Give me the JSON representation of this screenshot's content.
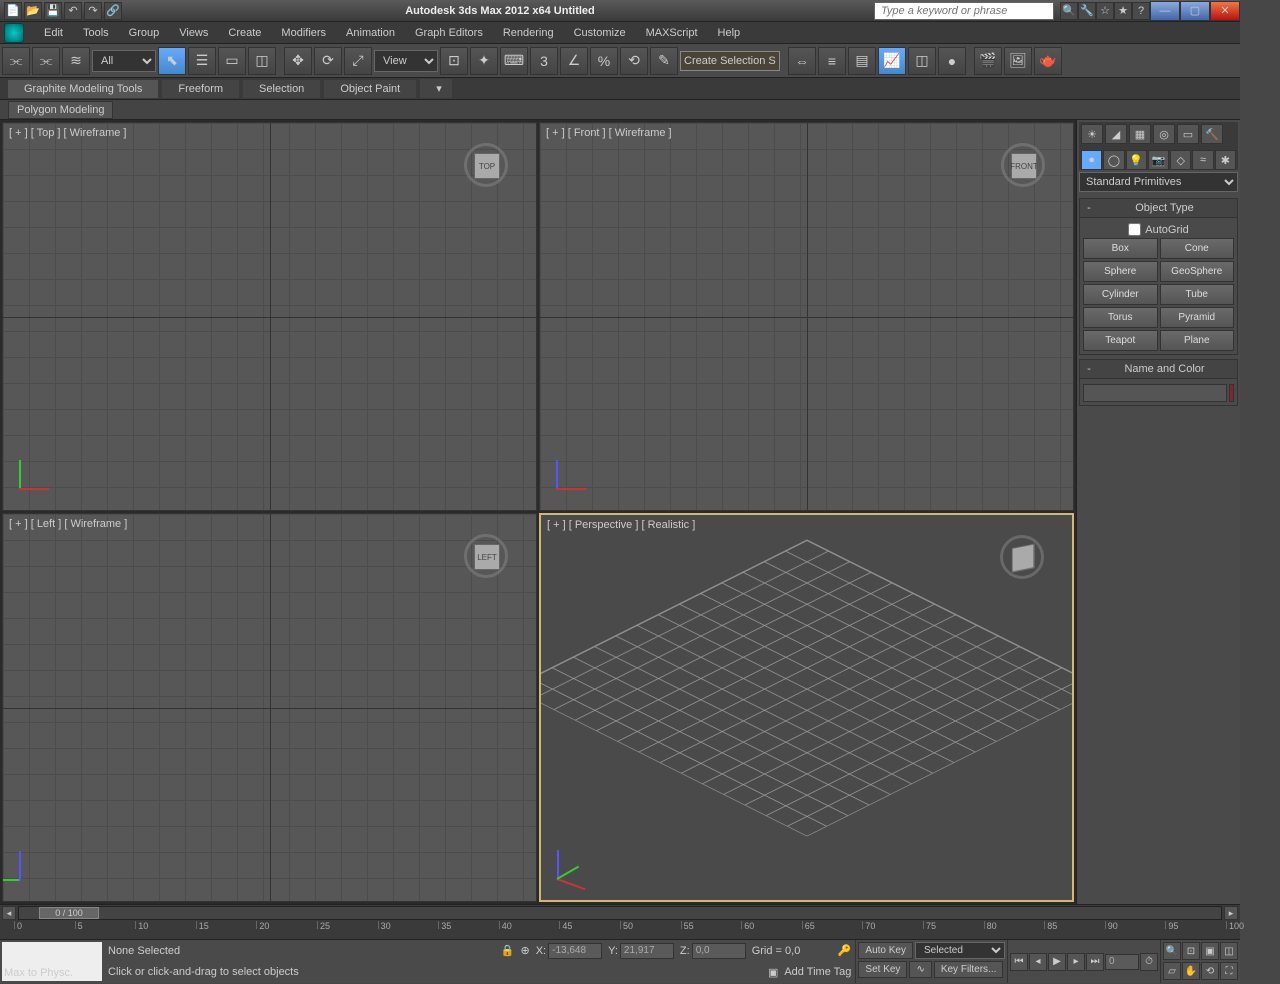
{
  "title": "Autodesk 3ds Max  2012 x64    Untitled",
  "search_placeholder": "Type a keyword or phrase",
  "menu": [
    "Edit",
    "Tools",
    "Group",
    "Views",
    "Create",
    "Modifiers",
    "Animation",
    "Graph Editors",
    "Rendering",
    "Customize",
    "MAXScript",
    "Help"
  ],
  "toolbar": {
    "filter": "All",
    "refsys": "View",
    "named_sel": "Create Selection Se"
  },
  "ribbon": {
    "tabs": [
      "Graphite Modeling Tools",
      "Freeform",
      "Selection",
      "Object Paint"
    ],
    "sub": "Polygon Modeling"
  },
  "viewports": {
    "top": "[ + ]  [ Top ]  [ Wireframe ]",
    "front": "[ + ]  [ Front ]  [ Wireframe ]",
    "left": "[ + ]  [ Left ]  [ Wireframe ]",
    "persp": "[ + ]  [ Perspective ]  [ Realistic ]",
    "cube_top": "TOP",
    "cube_front": "FRONT",
    "cube_left": "LEFT"
  },
  "panel": {
    "category": "Standard Primitives",
    "rollout1": "Object Type",
    "autogrid": "AutoGrid",
    "objects": [
      "Box",
      "Cone",
      "Sphere",
      "GeoSphere",
      "Cylinder",
      "Tube",
      "Torus",
      "Pyramid",
      "Teapot",
      "Plane"
    ],
    "rollout2": "Name and Color"
  },
  "timeline": {
    "handle": "0 / 100",
    "ticks": [
      0,
      5,
      10,
      15,
      20,
      25,
      30,
      35,
      40,
      45,
      50,
      55,
      60,
      65,
      70,
      75,
      80,
      85,
      90,
      95,
      100
    ]
  },
  "status": {
    "selection": "None Selected",
    "prompt": "Click or click-and-drag to select objects",
    "x_label": "X:",
    "x_val": "-13,648",
    "y_label": "Y:",
    "y_val": "21,917",
    "z_label": "Z:",
    "z_val": "0,0",
    "grid": "Grid = 0,0",
    "add_tag": "Add Time Tag",
    "auto_key": "Auto Key",
    "set_key": "Set Key",
    "key_mode": "Selected",
    "key_filters": "Key Filters...",
    "frame": "0",
    "script": "Max to Physc."
  }
}
